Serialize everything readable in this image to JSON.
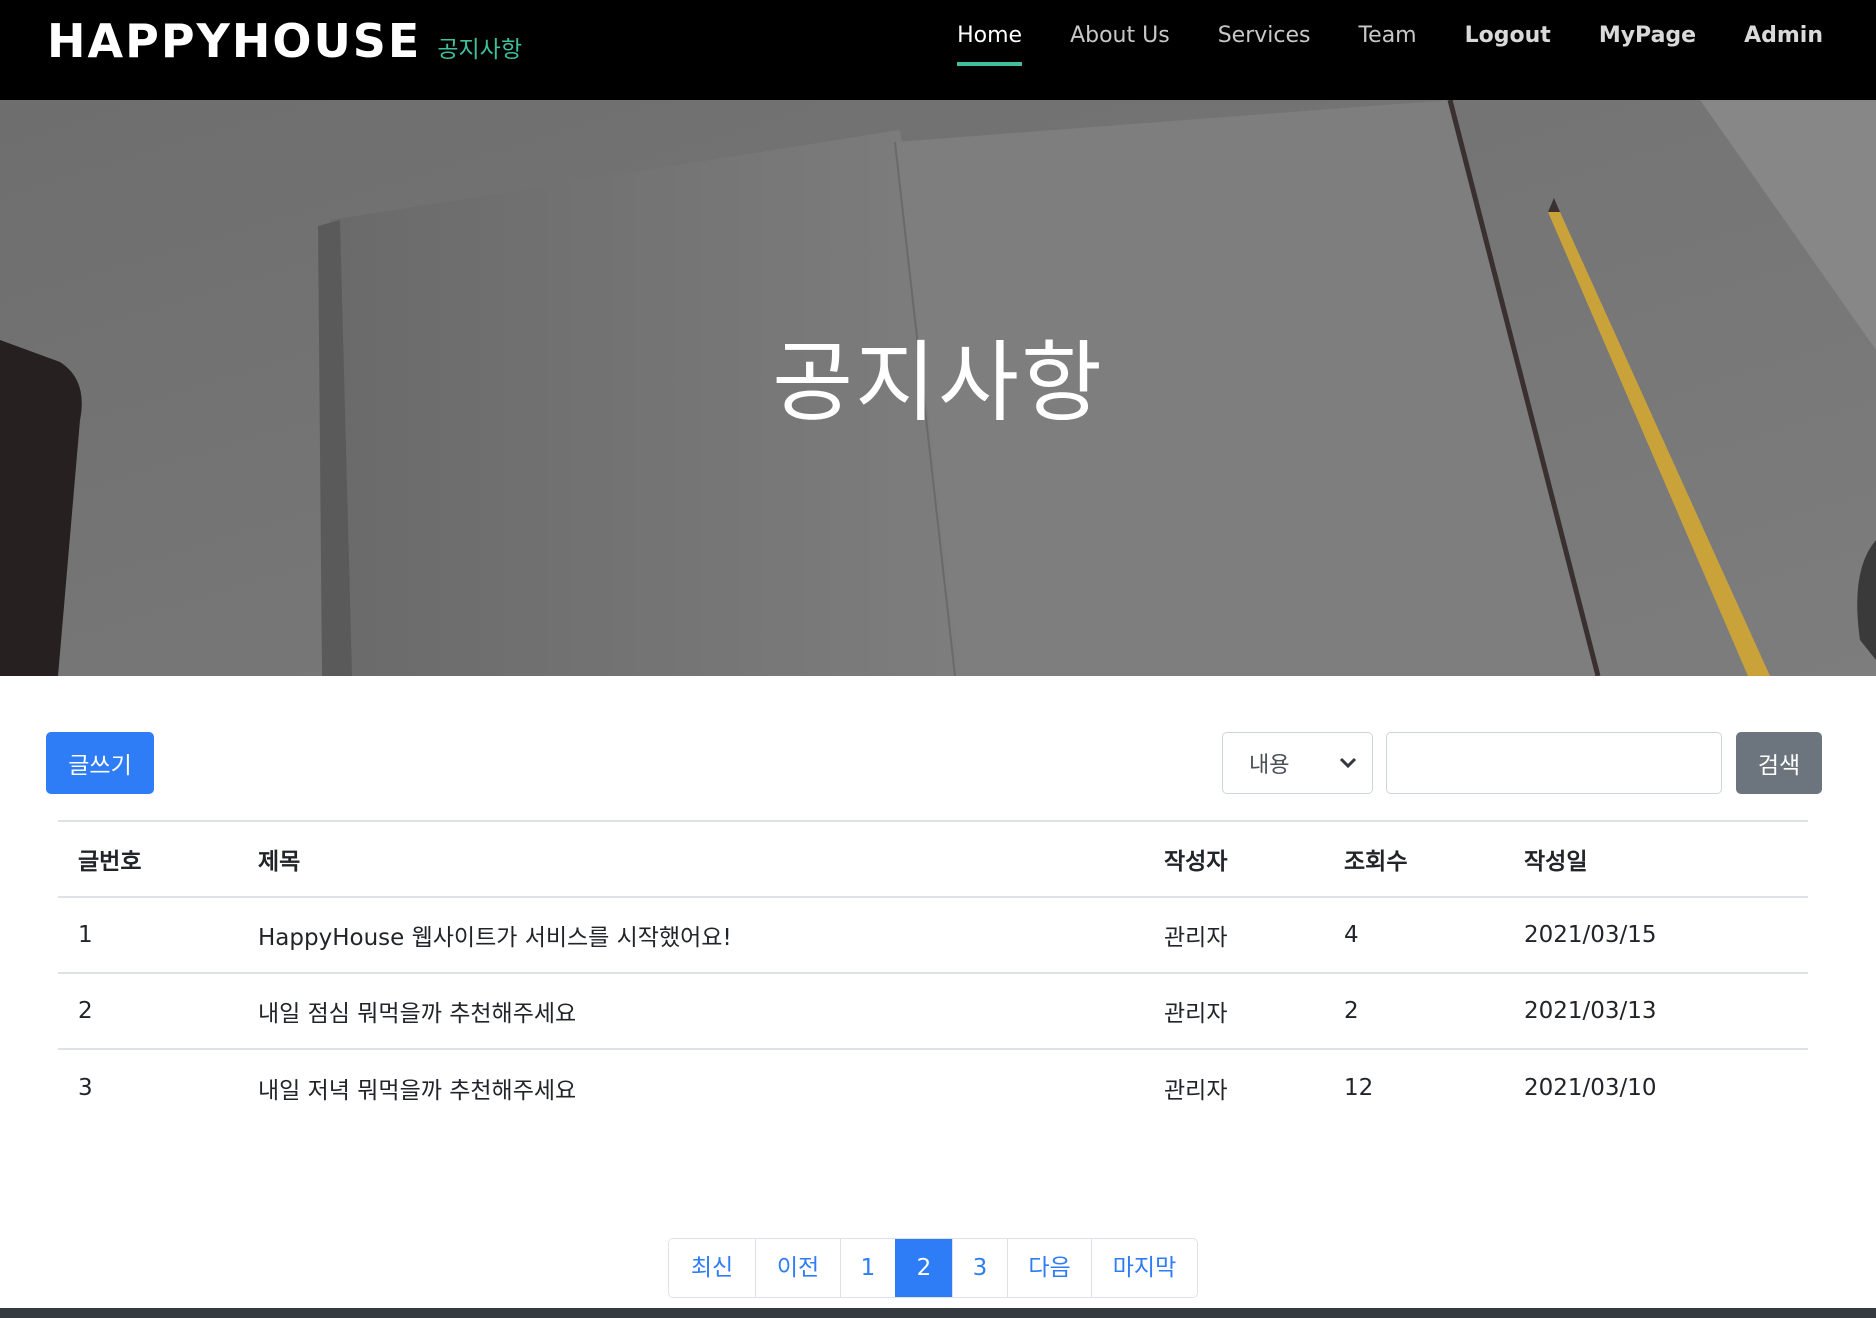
{
  "navbar": {
    "brand_title": "HAPPYHOUSE",
    "brand_sub": "공지사항",
    "items": [
      {
        "label": "Home"
      },
      {
        "label": "About Us"
      },
      {
        "label": "Services"
      },
      {
        "label": "Team"
      },
      {
        "label": "Logout"
      },
      {
        "label": "MyPage"
      },
      {
        "label": "Admin"
      }
    ]
  },
  "hero": {
    "title": "공지사항"
  },
  "toolbar": {
    "write_label": "글쓰기",
    "search_field_selected": "내용",
    "search_value": "",
    "search_button_label": "검색"
  },
  "table": {
    "headers": [
      "글번호",
      "제목",
      "작성자",
      "조회수",
      "작성일"
    ],
    "rows": [
      {
        "no": "1",
        "title": "HappyHouse 웹사이트가 서비스를 시작했어요!",
        "writer": "관리자",
        "hits": "4",
        "date": "2021/03/15"
      },
      {
        "no": "2",
        "title": "내일 점심 뭐먹을까 추천해주세요",
        "writer": "관리자",
        "hits": "2",
        "date": "2021/03/13"
      },
      {
        "no": "3",
        "title": "내일 저녁 뭐먹을까 추천해주세요",
        "writer": "관리자",
        "hits": "12",
        "date": "2021/03/10"
      }
    ]
  },
  "pagination": {
    "items": [
      "최신",
      "이전",
      "1",
      "2",
      "3",
      "다음",
      "마지막"
    ],
    "active": "2"
  },
  "colors": {
    "accent": "#3fbf9c",
    "primary": "#2e7cf6",
    "secondary": "#6c757d",
    "navbar_bg": "#000000"
  }
}
